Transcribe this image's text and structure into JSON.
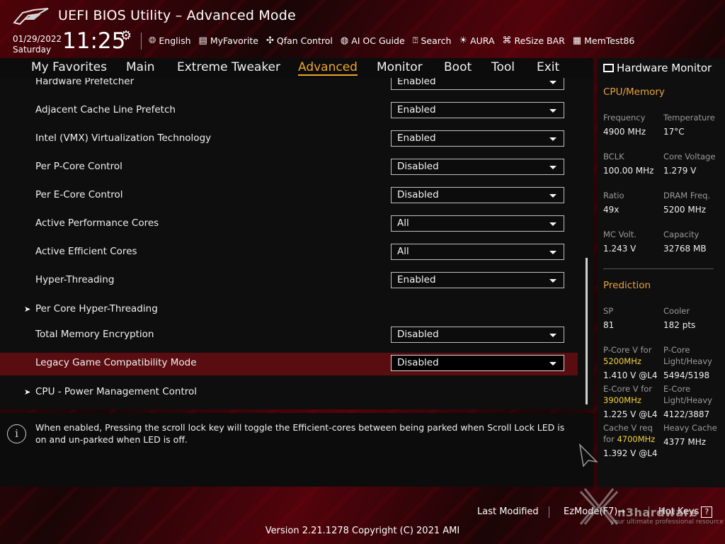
{
  "header": {
    "title": "UEFI BIOS Utility – Advanced Mode",
    "date": "01/29/2022",
    "day": "Saturday",
    "time": "11:25",
    "tools": [
      {
        "label": "English",
        "icon": "globe-icon"
      },
      {
        "label": "MyFavorite",
        "icon": "favorite-icon"
      },
      {
        "label": "Qfan Control",
        "icon": "fan-icon"
      },
      {
        "label": "AI OC Guide",
        "icon": "ai-oc-icon"
      },
      {
        "label": "Search",
        "icon": "search-icon"
      },
      {
        "label": "AURA",
        "icon": "aura-icon"
      },
      {
        "label": "ReSize BAR",
        "icon": "resize-bar-icon"
      },
      {
        "label": "MemTest86",
        "icon": "memtest-icon"
      }
    ]
  },
  "menu": {
    "items": [
      "My Favorites",
      "Main",
      "Extreme Tweaker",
      "Advanced",
      "Monitor",
      "Boot",
      "Tool",
      "Exit"
    ],
    "active": "Advanced"
  },
  "settings": [
    {
      "label": "Hardware Prefetcher",
      "value": "Enabled"
    },
    {
      "label": "Adjacent Cache Line Prefetch",
      "value": "Enabled"
    },
    {
      "label": "Intel (VMX) Virtualization Technology",
      "value": "Enabled"
    },
    {
      "label": "Per P-Core Control",
      "value": "Disabled"
    },
    {
      "label": "Per E-Core Control",
      "value": "Disabled"
    },
    {
      "label": "Active Performance Cores",
      "value": "All"
    },
    {
      "label": "Active Efficient Cores",
      "value": "All"
    },
    {
      "label": "Hyper-Threading",
      "value": "Enabled"
    },
    {
      "label": "Per Core Hyper-Threading",
      "submenu": true
    },
    {
      "label": "Total Memory Encryption",
      "value": "Disabled"
    },
    {
      "label": "Legacy Game Compatibility Mode",
      "value": "Disabled",
      "selected": true
    },
    {
      "label": "CPU - Power Management Control",
      "submenu": true
    }
  ],
  "help": {
    "text": "When enabled, Pressing the scroll lock key will toggle the Efficient-cores between being parked when Scroll Lock LED is on and un-parked when LED is off."
  },
  "hw_monitor": {
    "title": "Hardware Monitor",
    "cpu_memory": {
      "heading": "CPU/Memory",
      "frequency_label": "Frequency",
      "frequency": "4900 MHz",
      "temperature_label": "Temperature",
      "temperature": "17°C",
      "bclk_label": "BCLK",
      "bclk": "100.00 MHz",
      "core_voltage_label": "Core Voltage",
      "core_voltage": "1.279 V",
      "ratio_label": "Ratio",
      "ratio": "49x",
      "dram_freq_label": "DRAM Freq.",
      "dram_freq": "5200 MHz",
      "mc_volt_label": "MC Volt.",
      "mc_volt": "1.243 V",
      "capacity_label": "Capacity",
      "capacity": "32768 MB"
    },
    "prediction": {
      "heading": "Prediction",
      "sp_label": "SP",
      "sp": "81",
      "cooler_label": "Cooler",
      "cooler": "182 pts",
      "pcore_v_label": "P-Core V for",
      "pcore_v_freq": "5200MHz",
      "pcore_v": "1.410 V @L4",
      "pcore_lh_label1": "P-Core",
      "pcore_lh_label2": "Light/Heavy",
      "pcore_lh": "5494/5198",
      "ecore_v_label": "E-Core V for",
      "ecore_v_freq": "3900MHz",
      "ecore_v": "1.225 V @L4",
      "ecore_lh_label1": "E-Core",
      "ecore_lh_label2": "Light/Heavy",
      "ecore_lh": "4122/3887",
      "cache_v_label1": "Cache V req",
      "cache_v_label2": "for",
      "cache_v_freq": "4700MHz",
      "cache_v": "1.392 V @L4",
      "heavy_cache_label": "Heavy Cache",
      "heavy_cache": "4377 MHz"
    }
  },
  "footer": {
    "last_modified": "Last Modified",
    "ezmode": "EzMode(F7)",
    "ezmode_arrow": "→",
    "hotkeys": "Hot Keys",
    "hotkeys_icon": "?",
    "version": "Version 2.21.1278 Copyright (C) 2021 AMI"
  },
  "watermark": {
    "brand": "n3hardware",
    "tagline": "your ultimate professional resource"
  }
}
